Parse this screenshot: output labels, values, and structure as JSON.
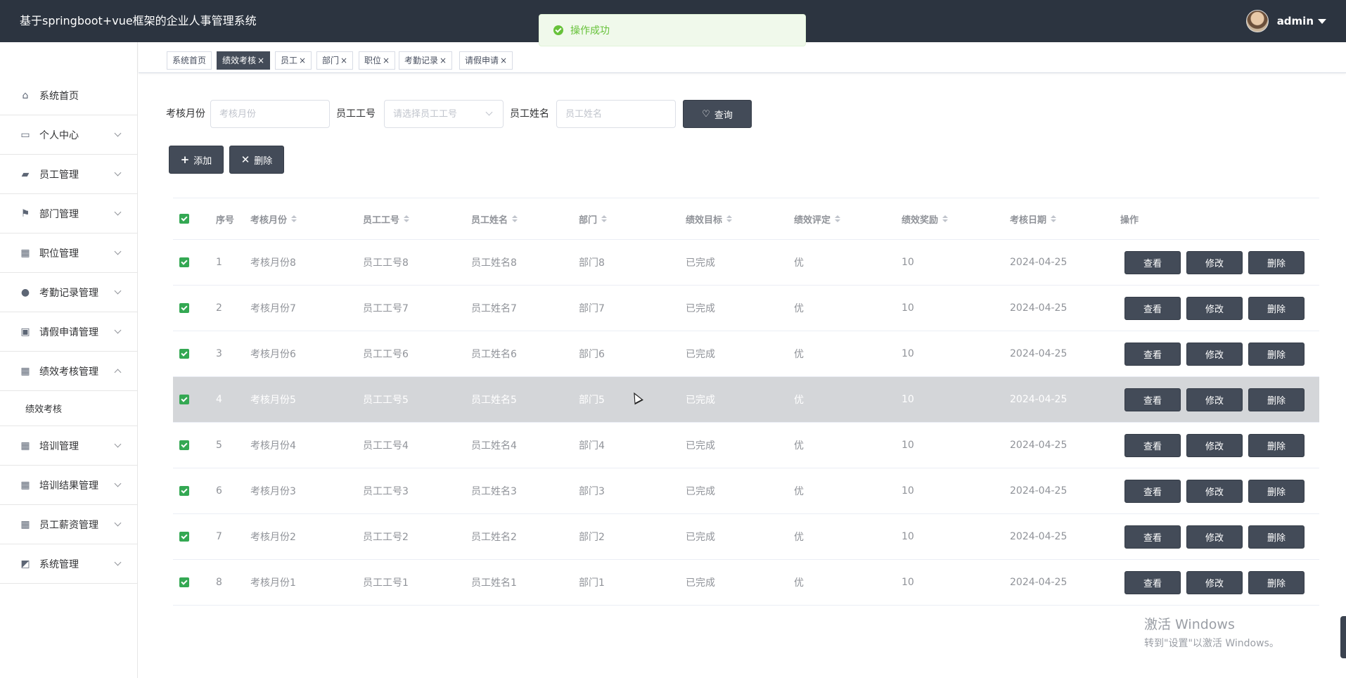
{
  "app": {
    "title": "基于springboot+vue框架的企业人事管理系统"
  },
  "user": {
    "name": "admin"
  },
  "toast": {
    "message": "操作成功"
  },
  "sidebar": {
    "items": [
      {
        "label": "系统首页",
        "icon": "home-icon",
        "has_arrow": false
      },
      {
        "label": "个人中心",
        "icon": "card-icon",
        "has_arrow": true
      },
      {
        "label": "员工管理",
        "icon": "ticket-icon",
        "has_arrow": true
      },
      {
        "label": "部门管理",
        "icon": "flag-icon",
        "has_arrow": true
      },
      {
        "label": "职位管理",
        "icon": "grid-icon",
        "has_arrow": true
      },
      {
        "label": "考勤记录管理",
        "icon": "person-icon",
        "has_arrow": true
      },
      {
        "label": "请假申请管理",
        "icon": "wallet-icon",
        "has_arrow": true
      },
      {
        "label": "绩效考核管理",
        "icon": "grid-icon",
        "has_arrow": true,
        "expanded": true
      },
      {
        "label": "培训管理",
        "icon": "grid-icon",
        "has_arrow": true
      },
      {
        "label": "培训结果管理",
        "icon": "grid-icon",
        "has_arrow": true
      },
      {
        "label": "员工薪资管理",
        "icon": "grid-icon",
        "has_arrow": true
      },
      {
        "label": "系统管理",
        "icon": "chart-icon",
        "has_arrow": true
      }
    ],
    "submenu": {
      "label": "绩效考核"
    }
  },
  "tags": [
    {
      "label": "系统首页",
      "closable": false,
      "active": false
    },
    {
      "label": "绩效考核",
      "closable": true,
      "active": true
    },
    {
      "label": "员工",
      "closable": true,
      "active": false
    },
    {
      "label": "部门",
      "closable": true,
      "active": false
    },
    {
      "label": "职位",
      "closable": true,
      "active": false
    },
    {
      "label": "考勤记录",
      "closable": true,
      "active": false
    },
    {
      "label": "请假申请",
      "closable": true,
      "active": false
    }
  ],
  "search": {
    "month_label": "考核月份",
    "month_placeholder": "考核月份",
    "empno_label": "员工工号",
    "empno_placeholder": "请选择员工工号",
    "name_label": "员工姓名",
    "name_placeholder": "员工姓名",
    "query_button": "查询"
  },
  "actions": {
    "add": "添加",
    "delete": "删除"
  },
  "table": {
    "columns": [
      "序号",
      "考核月份",
      "员工工号",
      "员工姓名",
      "部门",
      "绩效目标",
      "绩效评定",
      "绩效奖励",
      "考核日期",
      "操作"
    ],
    "sortable": [
      false,
      true,
      true,
      true,
      true,
      true,
      true,
      true,
      true,
      false
    ],
    "op_labels": {
      "view": "查看",
      "edit": "修改",
      "delete": "删除"
    },
    "rows": [
      [
        "1",
        "考核月份8",
        "员工工号8",
        "员工姓名8",
        "部门8",
        "已完成",
        "优",
        "10",
        "2024-04-25"
      ],
      [
        "2",
        "考核月份7",
        "员工工号7",
        "员工姓名7",
        "部门7",
        "已完成",
        "优",
        "10",
        "2024-04-25"
      ],
      [
        "3",
        "考核月份6",
        "员工工号6",
        "员工姓名6",
        "部门6",
        "已完成",
        "优",
        "10",
        "2024-04-25"
      ],
      [
        "4",
        "考核月份5",
        "员工工号5",
        "员工姓名5",
        "部门5",
        "已完成",
        "优",
        "10",
        "2024-04-25"
      ],
      [
        "5",
        "考核月份4",
        "员工工号4",
        "员工姓名4",
        "部门4",
        "已完成",
        "优",
        "10",
        "2024-04-25"
      ],
      [
        "6",
        "考核月份3",
        "员工工号3",
        "员工姓名3",
        "部门3",
        "已完成",
        "优",
        "10",
        "2024-04-25"
      ],
      [
        "7",
        "考核月份2",
        "员工工号2",
        "员工姓名2",
        "部门2",
        "已完成",
        "优",
        "10",
        "2024-04-25"
      ],
      [
        "8",
        "考核月份1",
        "员工工号1",
        "员工姓名1",
        "部门1",
        "已完成",
        "优",
        "10",
        "2024-04-25"
      ]
    ],
    "hover_row": 3
  },
  "watermark": {
    "title": "激活 Windows",
    "subtitle": "转到\"设置\"以激活 Windows。"
  }
}
